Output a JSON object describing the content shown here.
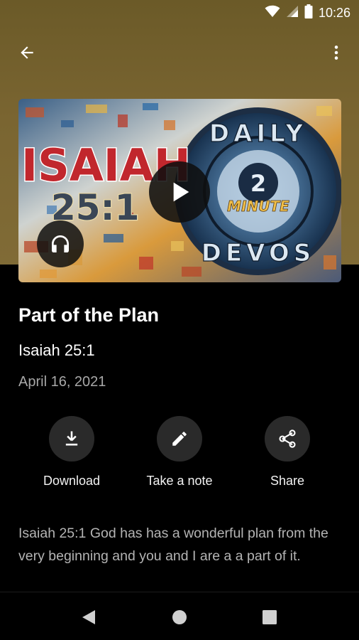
{
  "status_bar": {
    "time": "10:26",
    "icons": [
      "wifi-icon",
      "signal-icon",
      "battery-icon"
    ]
  },
  "app_bar": {
    "back_icon": "arrow-back-icon",
    "more_icon": "more-vert-icon"
  },
  "thumbnail": {
    "title_text": "ISAIAH",
    "verse_text": "25:1",
    "badge_top": "DAILY",
    "badge_number": "2",
    "badge_minute": "MINUTE",
    "badge_bottom": "DEVOS",
    "play_icon": "play-icon",
    "audio_icon": "headphones-icon"
  },
  "episode": {
    "title": "Part of the Plan",
    "reference": "Isaiah 25:1",
    "date": "April 16, 2021"
  },
  "actions": [
    {
      "label": "Download",
      "icon": "download-icon"
    },
    {
      "label": "Take a note",
      "icon": "pencil-icon"
    },
    {
      "label": "Share",
      "icon": "share-icon"
    }
  ],
  "description": "Isaiah 25:1 God has has a wonderful plan from the very beginning and you and I are a a part of it.",
  "nav_bar": {
    "icons": [
      "nav-back-icon",
      "nav-home-icon",
      "nav-recents-icon"
    ]
  },
  "colors": {
    "header_gold": "#7a6531",
    "background": "#000000",
    "action_circle": "#2a2a2a",
    "date_text": "#a8a8a8",
    "description_text": "#b4b4b4",
    "thumb_red": "#c1272d"
  }
}
